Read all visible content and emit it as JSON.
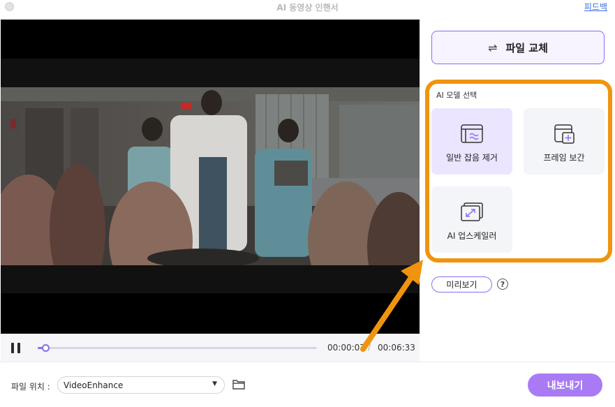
{
  "window": {
    "title": "AI 동영상 인핸서",
    "feedback_link": "피드백"
  },
  "player": {
    "current_time": "00:00:07",
    "total_time": "00:06:33",
    "separator": "/",
    "progress": 0.018
  },
  "side": {
    "replace_button": "파일 교체",
    "model_section_title": "AI 모델 선택",
    "models": [
      {
        "label": "일반 잡음 제거",
        "icon": "denoise-icon",
        "selected": true
      },
      {
        "label": "프레임 보간",
        "icon": "frame-interpolation-icon",
        "selected": false
      },
      {
        "label": "AI 업스케일러",
        "icon": "upscale-icon",
        "selected": false
      }
    ],
    "preview_button": "미리보기",
    "help_icon": "?"
  },
  "footer": {
    "location_label": "파일 위치 :",
    "location_value": "VideoEnhance",
    "export_button": "내보내기"
  },
  "colors": {
    "accent": "#8e6cf2",
    "export": "#a87bf5",
    "highlight": "#f0940e",
    "selected_card": "#ece5ff",
    "feedback_link": "#3b6fe0"
  }
}
